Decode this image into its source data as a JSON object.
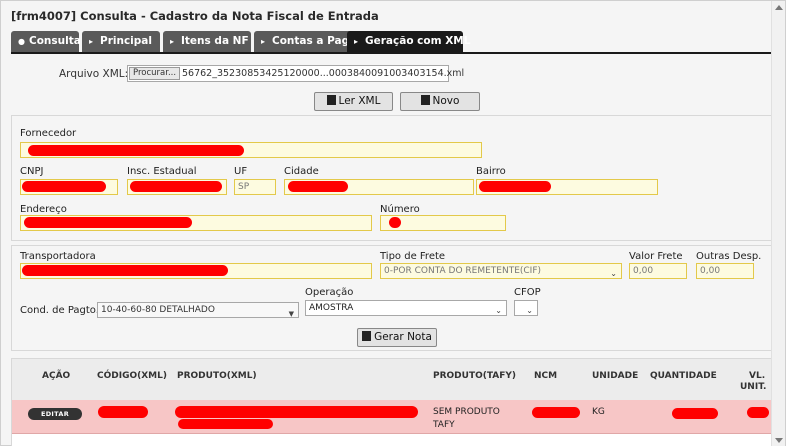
{
  "window": {
    "title": "[frm4007] Consulta - Cadastro da Nota Fiscal de Entrada"
  },
  "tabs": [
    {
      "label": "Consulta",
      "icon": "search-icon"
    },
    {
      "label": "Principal",
      "icon": "chevron-right-icon"
    },
    {
      "label": "Itens da NF",
      "icon": "chevron-right-icon"
    },
    {
      "label": "Contas a Pagar",
      "icon": "chevron-right-icon"
    },
    {
      "label": "Geração com XML",
      "icon": "chevron-right-icon",
      "active": true
    }
  ],
  "xml": {
    "label": "Arquivo XML:",
    "browse_label": "Procurar...",
    "file_name": "56762_35230853425120000...0003840091003403154.xml"
  },
  "actions": {
    "ler_xml": "Ler XML",
    "novo": "Novo",
    "gerar_nota": "Gerar Nota"
  },
  "supplier": {
    "fornecedor_label": "Fornecedor",
    "fornecedor_value": "",
    "cnpj_label": "CNPJ",
    "insc_estadual_label": "Insc. Estadual",
    "uf_label": "UF",
    "uf_value": "SP",
    "cidade_label": "Cidade",
    "bairro_label": "Bairro",
    "endereco_label": "Endereço",
    "numero_label": "Número"
  },
  "transport": {
    "transportadora_label": "Transportadora",
    "tipo_frete_label": "Tipo de Frete",
    "tipo_frete_value": "0-POR CONTA DO REMETENTE(CIF)",
    "valor_frete_label": "Valor Frete",
    "valor_frete_value": "0,00",
    "outras_desp_label": "Outras Desp.",
    "outras_desp_value": "0,00",
    "cond_pagto_label": "Cond. de Pagto.",
    "cond_pagto_value": "10-40-60-80 DETALHADO",
    "operacao_label": "Operação",
    "operacao_value": "AMOSTRA",
    "cfop_label": "CFOP",
    "cfop_value": ""
  },
  "grid": {
    "headers": [
      "AÇÃO",
      "CÓDIGO(XML)",
      "PRODUTO(XML)",
      "PRODUTO(TAFY)",
      "NCM",
      "UNIDADE",
      "QUANTIDADE",
      "VL.",
      "UNIT."
    ],
    "rows": [
      {
        "action": "EDITAR",
        "produto_tafy_1": "SEM PRODUTO",
        "produto_tafy_2": "TAFY",
        "unidade": "KG"
      }
    ]
  },
  "colors": {
    "tab_active": "#1a1a1a",
    "tab_inactive": "#5a5a5a",
    "redaction": "#ff0000",
    "row_highlight": "#f7c6c6",
    "field_yellow": "#fdfbe0"
  }
}
